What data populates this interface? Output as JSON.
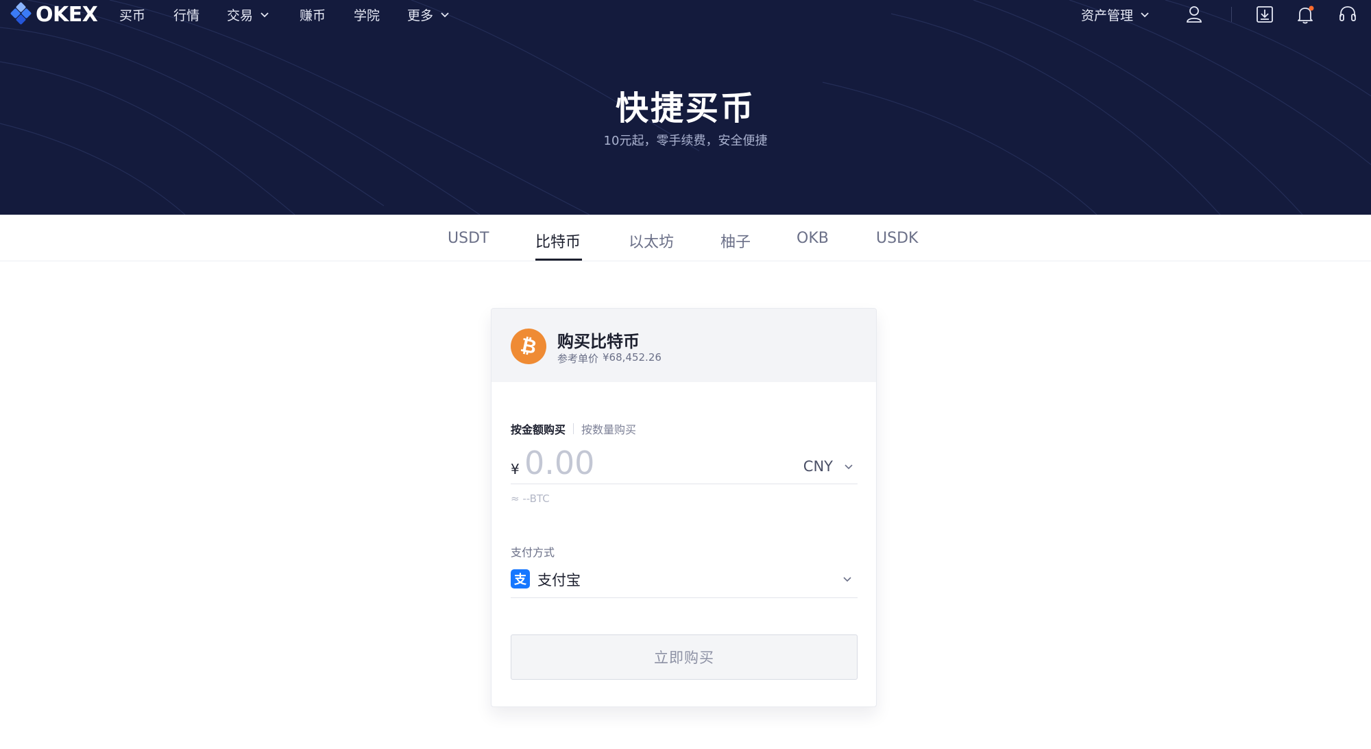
{
  "colors": {
    "hero_bg": "#141b3d",
    "brand_blue": "#3b7bf6",
    "bitcoin_orange": "#ef8b34",
    "alipay_blue": "#1677ff",
    "notification_dot": "#ff6b2c"
  },
  "nav": {
    "logo_text": "OKEX",
    "items": [
      {
        "label": "买币",
        "dropdown": false
      },
      {
        "label": "行情",
        "dropdown": false
      },
      {
        "label": "交易",
        "dropdown": true
      },
      {
        "label": "赚币",
        "dropdown": false
      },
      {
        "label": "学院",
        "dropdown": false
      },
      {
        "label": "更多",
        "dropdown": true
      }
    ],
    "asset_management": "资产管理",
    "icons": [
      "user-icon",
      "download-icon",
      "bell-icon",
      "headset-icon"
    ]
  },
  "hero": {
    "title": "快捷买币",
    "subtitle": "10元起，零手续费，安全便捷"
  },
  "tabs": [
    {
      "label": "USDT",
      "active": false
    },
    {
      "label": "比特币",
      "active": true
    },
    {
      "label": "以太坊",
      "active": false
    },
    {
      "label": "柚子",
      "active": false
    },
    {
      "label": "OKB",
      "active": false
    },
    {
      "label": "USDK",
      "active": false
    }
  ],
  "card": {
    "coin_icon": "bitcoin-icon",
    "title": "购买比特币",
    "ref_price_label": "参考单价",
    "ref_price_value": "¥68,452.26",
    "mode_tabs": [
      "按金额购买",
      "按数量购买"
    ],
    "active_mode": "按金额购买",
    "currency_sign": "¥",
    "amount_placeholder": "0.00",
    "amount_value": "",
    "currency": "CNY",
    "approx": "≈ --BTC",
    "payment_label": "支付方式",
    "payment_icon": "alipay-icon",
    "payment_method": "支付宝",
    "buy_button": "立即购买"
  }
}
